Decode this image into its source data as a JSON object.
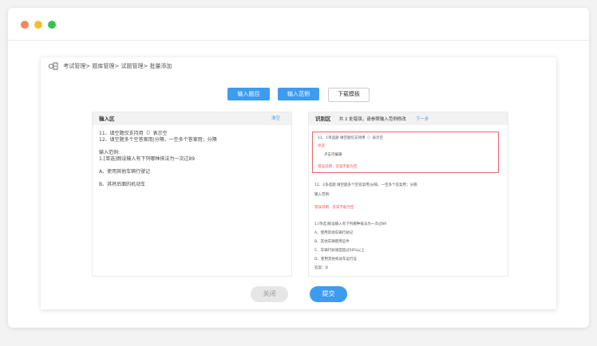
{
  "window": {
    "controls": [
      "close",
      "minimize",
      "maximize"
    ]
  },
  "breadcrumb": {
    "items": [
      "考试管理>",
      "题库管理>",
      "试题管理>",
      "批量添加"
    ]
  },
  "toolbar": {
    "input_question": "输入题目",
    "input_answer": "输入范例",
    "download_template": "下载模板"
  },
  "input_area": {
    "title": "输入区",
    "link": "清空",
    "lines": [
      "11、填空题仅支持用（）表示空",
      "12、填空题多个空答案用|分隔，一空多个答案用；分隔",
      "",
      "输入范例:",
      "1.[单选]假设输入有下列哪种排法为一次过89",
      "",
      "A、使用其他车辆行驶记",
      "",
      "B、其将后面的机动车"
    ]
  },
  "check_area": {
    "title": "识别区",
    "summary": "共 2 处错误，请参照输入范例修改",
    "next": "下一步",
    "q1": {
      "line": "11、1单选题 填空题仅支持用（）表示空",
      "tag": "单选",
      "option": "点击可编辑",
      "error": "错误说明：答案不能为空"
    },
    "q2": {
      "line": "12、2多选题 填空题多个空答案用|分隔，一空多个答案用；分隔",
      "sub": "输入范例:",
      "error": "错误说明：答案不能为空"
    },
    "example": {
      "stem": "1.[单选]假设输入有下列哪种排法为一次过89",
      "options": [
        "A、使用其他车辆行驶记",
        "B、其他车辆使用证件",
        "C、车辆行驶速度超过50%以上",
        "D、使用其他机动车运行证"
      ],
      "answer": "答案：D"
    }
  },
  "footer": {
    "close": "关闭",
    "submit": "提交"
  },
  "colors": {
    "accent": "#3d9cf0",
    "error": "#e55555"
  }
}
